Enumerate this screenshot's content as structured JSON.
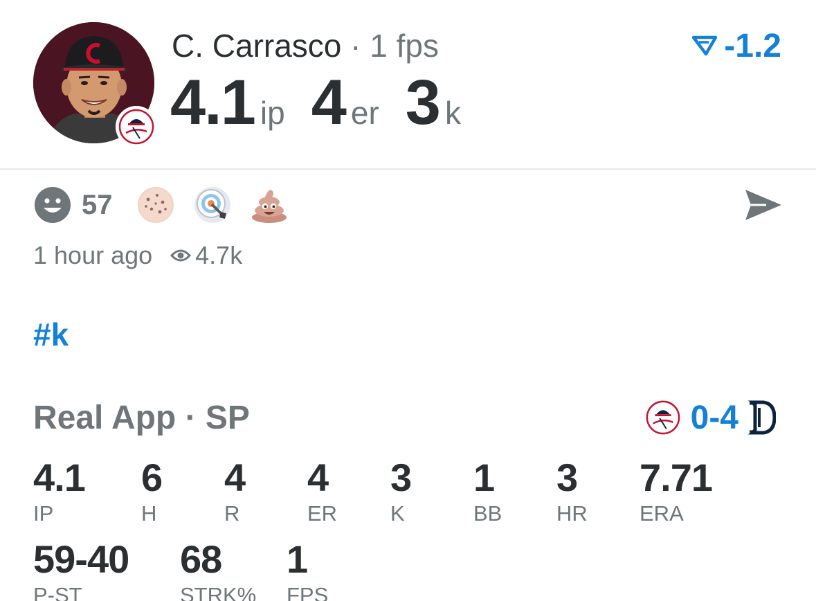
{
  "player": {
    "name": "C. Carrasco",
    "separator": "·",
    "fps": "1 fps",
    "photo_icon": "player-headshot",
    "team_logo_icon": "yankees-logo",
    "delta_icon": "dfs-logo-icon",
    "delta": "-1.2"
  },
  "headline_stats": [
    {
      "value": "4.1",
      "unit": "ip"
    },
    {
      "value": "4",
      "unit": "er"
    },
    {
      "value": "3",
      "unit": "k"
    }
  ],
  "reactions": {
    "smiley_icon": "smiley-icon",
    "count": "57",
    "emojis": [
      "cookie-emoji",
      "target-emoji",
      "poop-emoji"
    ],
    "send_icon": "send-icon"
  },
  "meta": {
    "time": "1 hour ago",
    "views_icon": "eye-icon",
    "views": "4.7k"
  },
  "hashtag": "#k",
  "game": {
    "title": "Real App · SP",
    "score": "0-4",
    "home_logo": "yankees-logo",
    "opponent_logo": "tigers-logo"
  },
  "stats": [
    {
      "value": "4.1",
      "label": "IP"
    },
    {
      "value": "6",
      "label": "H"
    },
    {
      "value": "4",
      "label": "R"
    },
    {
      "value": "4",
      "label": "ER"
    },
    {
      "value": "3",
      "label": "K"
    },
    {
      "value": "1",
      "label": "BB"
    },
    {
      "value": "3",
      "label": "HR"
    },
    {
      "value": "7.71",
      "label": "ERA"
    },
    {
      "value": "59-40",
      "label": "P-ST"
    },
    {
      "value": "68",
      "label": "STRK%"
    },
    {
      "value": "1",
      "label": "FPS"
    }
  ],
  "colors": {
    "accent": "#1480d8",
    "text": "#2b2f31",
    "muted": "#6f7679",
    "avatar_bg": "#4a1422"
  }
}
